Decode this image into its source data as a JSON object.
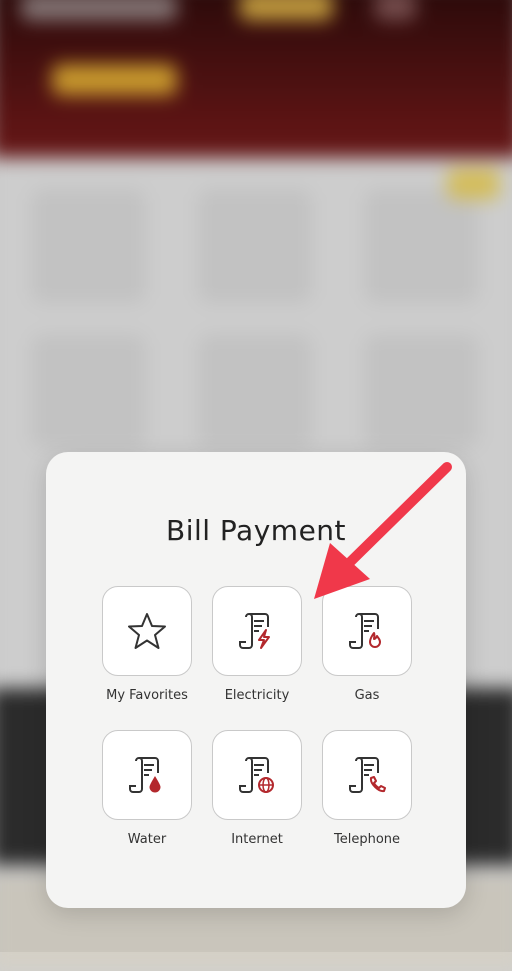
{
  "modal": {
    "title": "Bill Payment",
    "categories": [
      {
        "label": "My Favorites",
        "icon": "star-icon"
      },
      {
        "label": "Electricity",
        "icon": "electricity-bill-icon"
      },
      {
        "label": "Gas",
        "icon": "gas-bill-icon"
      },
      {
        "label": "Water",
        "icon": "water-bill-icon"
      },
      {
        "label": "Internet",
        "icon": "internet-bill-icon"
      },
      {
        "label": "Telephone",
        "icon": "telephone-bill-icon"
      }
    ]
  },
  "colors": {
    "accent": "#b3282d",
    "icon_stroke": "#333333",
    "annotation_arrow": "#f0384a"
  }
}
